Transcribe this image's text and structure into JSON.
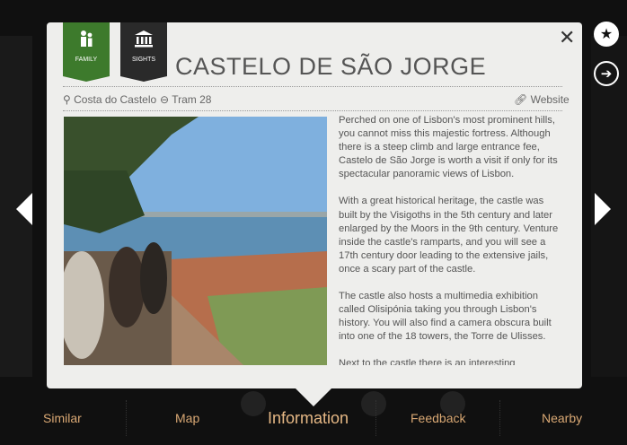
{
  "side": {
    "star_icon": "star-icon",
    "share_icon": "share-icon"
  },
  "tabs": [
    {
      "label": "FAMILY",
      "icon": "family-icon"
    },
    {
      "label": "SIGHTS",
      "icon": "museum-icon"
    }
  ],
  "title": "CASTELO DE SÃO JORGE",
  "meta": {
    "location": "Costa do Castelo",
    "transport": "Tram 28",
    "website": "Website"
  },
  "description": [
    "Perched on one of Lisbon's most prominent hills, you cannot miss this majestic fortress. Although there is a steep climb and large entrance fee, Castelo de São Jorge is worth a visit if only for its spectacular panoramic views of Lisbon.",
    "With a great historical heritage, the castle was built by the Visigoths in the 5th century and later enlarged by the Moors in the 9th century. Venture inside the castle's ramparts, and you will see a 17th century door leading to the extensive jails, once a scary part of the castle.",
    "The castle also hosts a multimedia exhibition called Olisipónia taking you through Lisbon's history. You will also find a camera obscura built into one of the 18 towers, the Torre de Ulisses.",
    "Next to the castle there is an interesting"
  ],
  "nav": {
    "similar": "Similar",
    "map": "Map",
    "information": "Information",
    "feedback": "Feedback",
    "nearby": "Nearby"
  },
  "colors": {
    "accent": "#d9a874",
    "family_tab": "#3d7a2c",
    "sights_tab": "#2a2a2a",
    "panel": "#eeeeec"
  }
}
